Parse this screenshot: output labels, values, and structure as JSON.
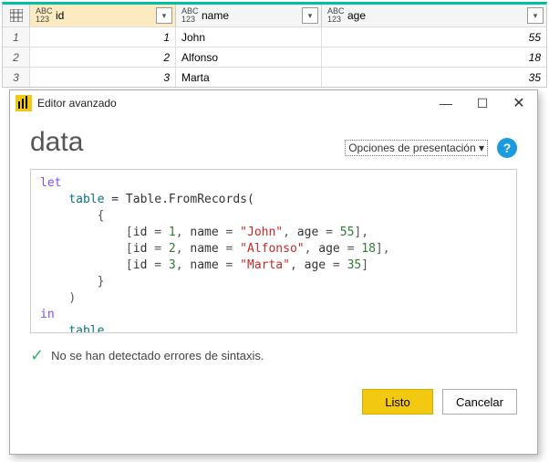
{
  "table": {
    "columns": [
      {
        "name": "id",
        "type": "ABC123"
      },
      {
        "name": "name",
        "type": "ABC123"
      },
      {
        "name": "age",
        "type": "ABC123"
      }
    ],
    "rows": [
      {
        "n": "1",
        "id": "1",
        "name": "John",
        "age": "55"
      },
      {
        "n": "2",
        "id": "2",
        "name": "Alfonso",
        "age": "18"
      },
      {
        "n": "3",
        "id": "3",
        "name": "Marta",
        "age": "35"
      }
    ]
  },
  "dialog": {
    "title": "Editor avanzado",
    "queryName": "data",
    "presentationOptions": "Opciones de presentación ▾",
    "status": "No se han detectado errores de sintaxis.",
    "buttons": {
      "done": "Listo",
      "cancel": "Cancelar"
    },
    "code": {
      "let": "let",
      "tableIdent": "table",
      "fromRecords": " = Table.FromRecords(",
      "openBrace": "{",
      "rows": [
        {
          "id": "1",
          "name": "\"John\"",
          "age": "55",
          "trail": ","
        },
        {
          "id": "2",
          "name": "\"Alfonso\"",
          "age": "18",
          "trail": ","
        },
        {
          "id": "3",
          "name": "\"Marta\"",
          "age": "35",
          "trail": ""
        }
      ],
      "closeBrace": "}",
      "closeParen": ")",
      "in": "in",
      "result": "table",
      "recPrefix": "[id = ",
      "recName": ", name = ",
      "recAge": ", age = ",
      "recClose": "]"
    }
  },
  "chart_data": {
    "type": "table",
    "columns": [
      "id",
      "name",
      "age"
    ],
    "rows": [
      [
        1,
        "John",
        55
      ],
      [
        2,
        "Alfonso",
        18
      ],
      [
        3,
        "Marta",
        35
      ]
    ]
  }
}
